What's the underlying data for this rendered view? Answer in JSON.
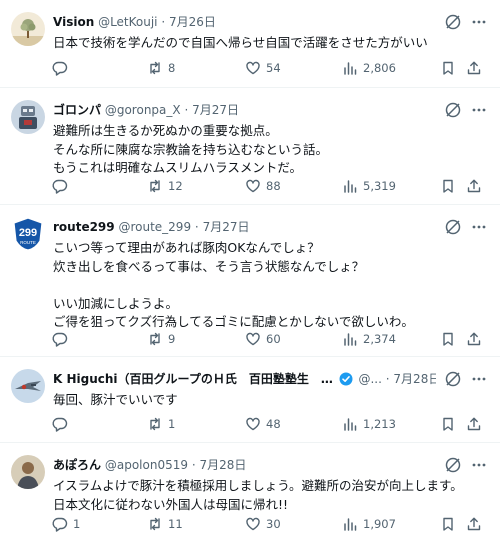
{
  "tweets": [
    {
      "name": "Vision",
      "handle": "@LetKouji",
      "dot": "·",
      "date": "7月26日",
      "verified": false,
      "lines": [
        "日本で技術を学んだので自国へ帰らせ自国で活躍をさせた方がいい"
      ],
      "reply": "",
      "retweet": "8",
      "like": "54",
      "views": "2,806",
      "avatar_icon": "tree-avatar"
    },
    {
      "name": "ゴロンパ",
      "handle": "@goronpa_X",
      "dot": "·",
      "date": "7月27日",
      "verified": false,
      "lines": [
        "避難所は生きるか死ぬかの重要な拠点。",
        "そんな所に陳腐な宗教論を持ち込むなという話。",
        "もうこれは明確なムスリムハラスメントだ。"
      ],
      "reply": "",
      "retweet": "12",
      "like": "88",
      "views": "5,319",
      "avatar_icon": "robot-avatar"
    },
    {
      "name": "route299",
      "handle": "@route_299",
      "dot": "·",
      "date": "7月27日",
      "verified": false,
      "lines": [
        "こいつ等って理由があれば豚肉OKなんでしょ？",
        "炊き出しを食べるって事は、そう言う状態なんでしょ？",
        "",
        "いい加減にしようよ。",
        "ご得を狙ってクズ行為してるゴミに配慮とかしないで欲しいわ。"
      ],
      "reply": "",
      "retweet": "9",
      "like": "60",
      "views": "2,374",
      "avatar_icon": "route-sign-avatar",
      "avatar_text": "299",
      "avatar_sub": "ROUTE"
    },
    {
      "name": "K Higuchi（百田グループのＨ氏　百田塾塾生　…",
      "handle": "@...",
      "dot": "·",
      "date": "7月28日",
      "verified": true,
      "lines": [
        "毎回、豚汁でいいです"
      ],
      "reply": "",
      "retweet": "1",
      "like": "48",
      "views": "1,213",
      "avatar_icon": "fighter-jet-avatar"
    },
    {
      "name": "あぽろん",
      "handle": "@apolon0519",
      "dot": "·",
      "date": "7月28日",
      "verified": false,
      "lines": [
        "イスラムよけで豚汁を積極採用しましょう。避難所の治安が向上します。",
        "日本文化に従わない外国人は母国に帰れ!!"
      ],
      "reply": "1",
      "retweet": "11",
      "like": "30",
      "views": "1,907",
      "avatar_icon": "person-avatar"
    }
  ],
  "colors": {
    "text": "#0f1419",
    "muted": "#536471",
    "divider": "#eff3f4",
    "verified": "#1d9bf0"
  }
}
